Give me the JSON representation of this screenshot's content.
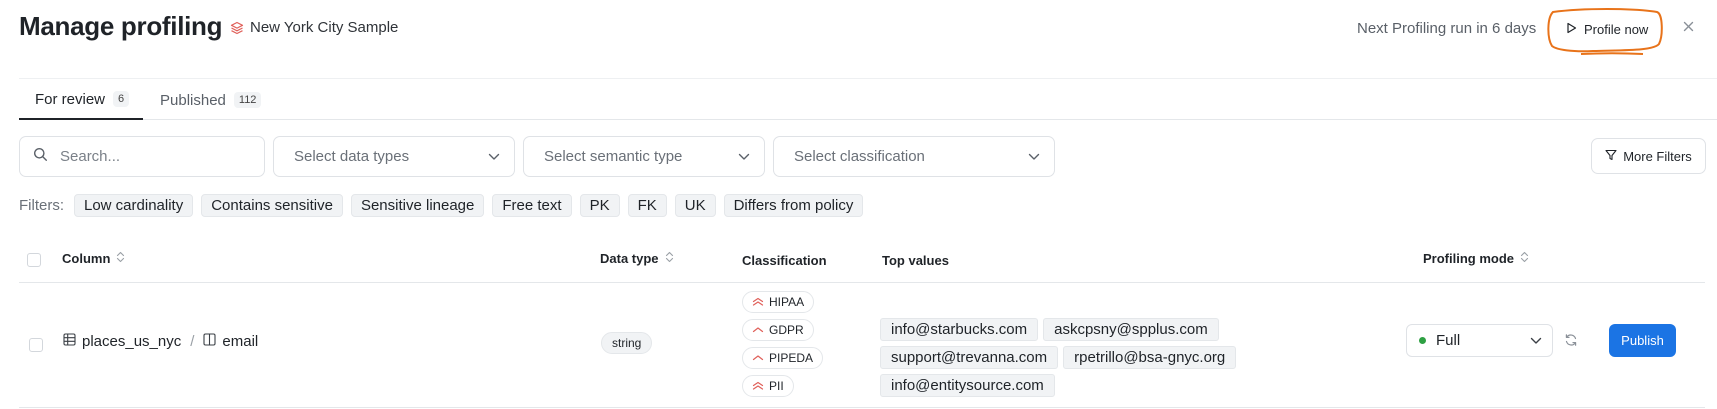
{
  "header": {
    "title": "Manage profiling",
    "dataset_name": "New York City Sample",
    "dataset_icon": "layers-icon",
    "next_run_text": "Next Profiling run in 6 days",
    "profile_now_label": "Profile now",
    "annotation_color": "#e8731a"
  },
  "tabs": [
    {
      "label": "For review",
      "count": "6",
      "active": true
    },
    {
      "label": "Published",
      "count": "112",
      "active": false
    }
  ],
  "filters": {
    "search_placeholder": "Search...",
    "data_types_placeholder": "Select data types",
    "semantic_type_placeholder": "Select semantic type",
    "classification_placeholder": "Select classification",
    "more_filters_label": "More Filters",
    "quick_label": "Filters:",
    "quick_chips": [
      "Low cardinality",
      "Contains sensitive",
      "Sensitive lineage",
      "Free text",
      "PK",
      "FK",
      "UK",
      "Differs from policy"
    ]
  },
  "table": {
    "headers": {
      "column": "Column",
      "data_type": "Data type",
      "classification": "Classification",
      "top_values": "Top values",
      "profiling_mode": "Profiling mode"
    },
    "rows": [
      {
        "table_name": "places_us_nyc",
        "column_name": "email",
        "data_type": "string",
        "classifications": [
          "HIPAA",
          "GDPR",
          "PIPEDA",
          "PII"
        ],
        "top_values": [
          "info@starbucks.com",
          "askcpsny@spplus.com",
          "support@trevanna.com",
          "rpetrillo@bsa-gnyc.org",
          "info@entitysource.com"
        ],
        "profiling_mode": "Full",
        "profiling_mode_status_color": "#2ea043",
        "publish_label": "Publish"
      }
    ]
  },
  "colors": {
    "accent": "#1b74e4",
    "classification_icon": "#e0605a"
  }
}
